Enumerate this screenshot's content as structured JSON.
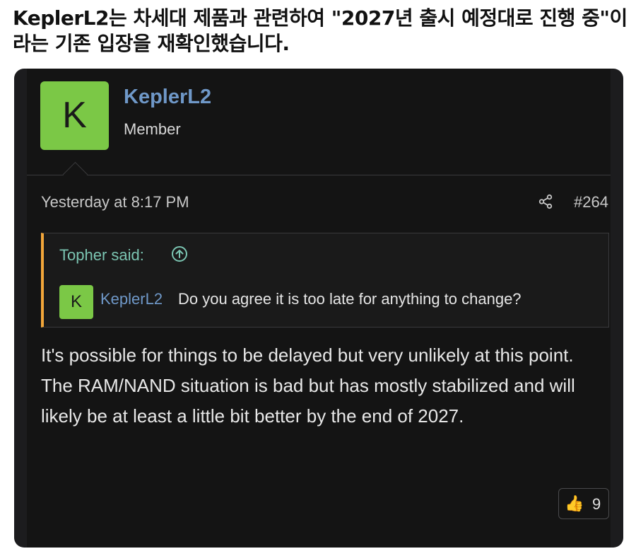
{
  "headline": "KeplerL2는 차세대 제품과 관련하여 \"2027년 출시 예정대로 진행 중\"이라는 기존 입장을 재확인했습니다.",
  "post": {
    "avatar_letter": "K",
    "username": "KeplerL2",
    "user_title": "Member",
    "date": "Yesterday at 8:17 PM",
    "post_number": "#264",
    "share_icon": "share-icon"
  },
  "quote": {
    "header": "Topher said:",
    "jump_icon": "arrow-up-circle-icon",
    "avatar_letter": "K",
    "user": "KeplerL2",
    "text": "Do you agree it is too late for anything to change?"
  },
  "body": {
    "text": "It's possible for things to be delayed but very unlikely at this point. The RAM/NAND situation is bad but has mostly stabilized and will likely be at least a little bit better by the end of 2027."
  },
  "reaction": {
    "icon": "thumbs-up-icon",
    "emoji": "👍",
    "count": "9"
  },
  "colors": {
    "accent_green": "#7bc846",
    "username_blue": "#6f98c8",
    "quote_border": "#f2a63a",
    "quote_header": "#7bc5b2"
  }
}
